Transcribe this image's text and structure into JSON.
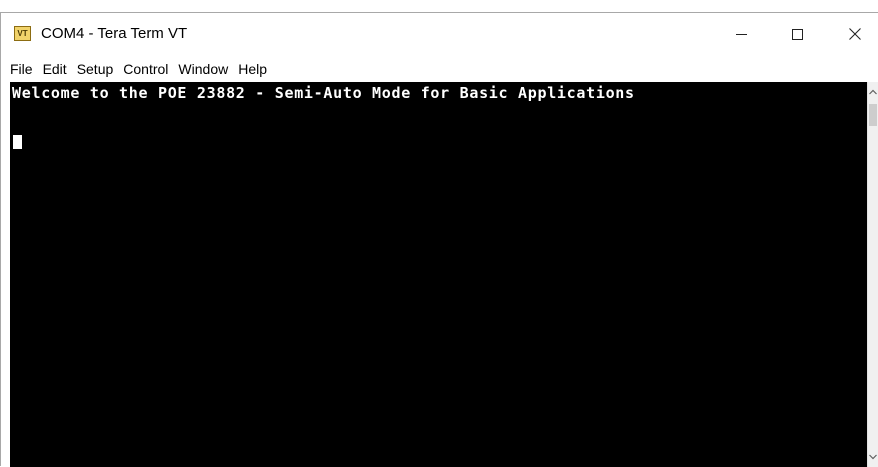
{
  "window": {
    "title": "COM4 - Tera Term VT",
    "icon_label": "VT",
    "icon": "tera-term-icon",
    "controls": {
      "minimize_icon": "minimize-icon",
      "maximize_icon": "maximize-icon",
      "close_icon": "close-icon"
    }
  },
  "menu": {
    "items": [
      {
        "label": "File"
      },
      {
        "label": "Edit"
      },
      {
        "label": "Setup"
      },
      {
        "label": "Control"
      },
      {
        "label": "Window"
      },
      {
        "label": "Help"
      }
    ]
  },
  "terminal": {
    "lines": [
      "Welcome to the POE 23882 - Semi-Auto Mode for Basic Applications"
    ],
    "background": "#000000",
    "foreground": "#ffffff"
  },
  "colors": {
    "titlebar": "#ffffff",
    "icon_fill": "#f1d36b"
  }
}
